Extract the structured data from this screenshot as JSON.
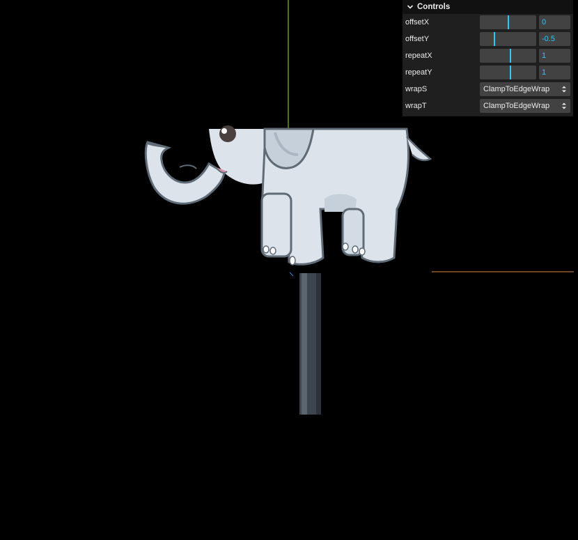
{
  "panel": {
    "title": "Controls",
    "rows": [
      {
        "label": "offsetX",
        "value": "0",
        "fraction": 0.5
      },
      {
        "label": "offsetY",
        "value": "-0.5",
        "fraction": 0.25
      },
      {
        "label": "repeatX",
        "value": "1",
        "fraction": 0.55
      },
      {
        "label": "repeatY",
        "value": "1",
        "fraction": 0.55
      }
    ],
    "selects": [
      {
        "label": "wrapS",
        "value": "ClampToEdgeWrap"
      },
      {
        "label": "wrapT",
        "value": "ClampToEdgeWrap"
      }
    ]
  },
  "colors": {
    "accent": "#2cc9ff",
    "axis_x": "#e08a3a",
    "axis_y": "#9ee03a",
    "axis_z": "#3a8ae0",
    "pole": "#40484f",
    "elephant_body": "#dde3ea"
  },
  "icons": {
    "collapse": "chevron-down-icon",
    "select_caret": "up-down-caret-icon"
  }
}
